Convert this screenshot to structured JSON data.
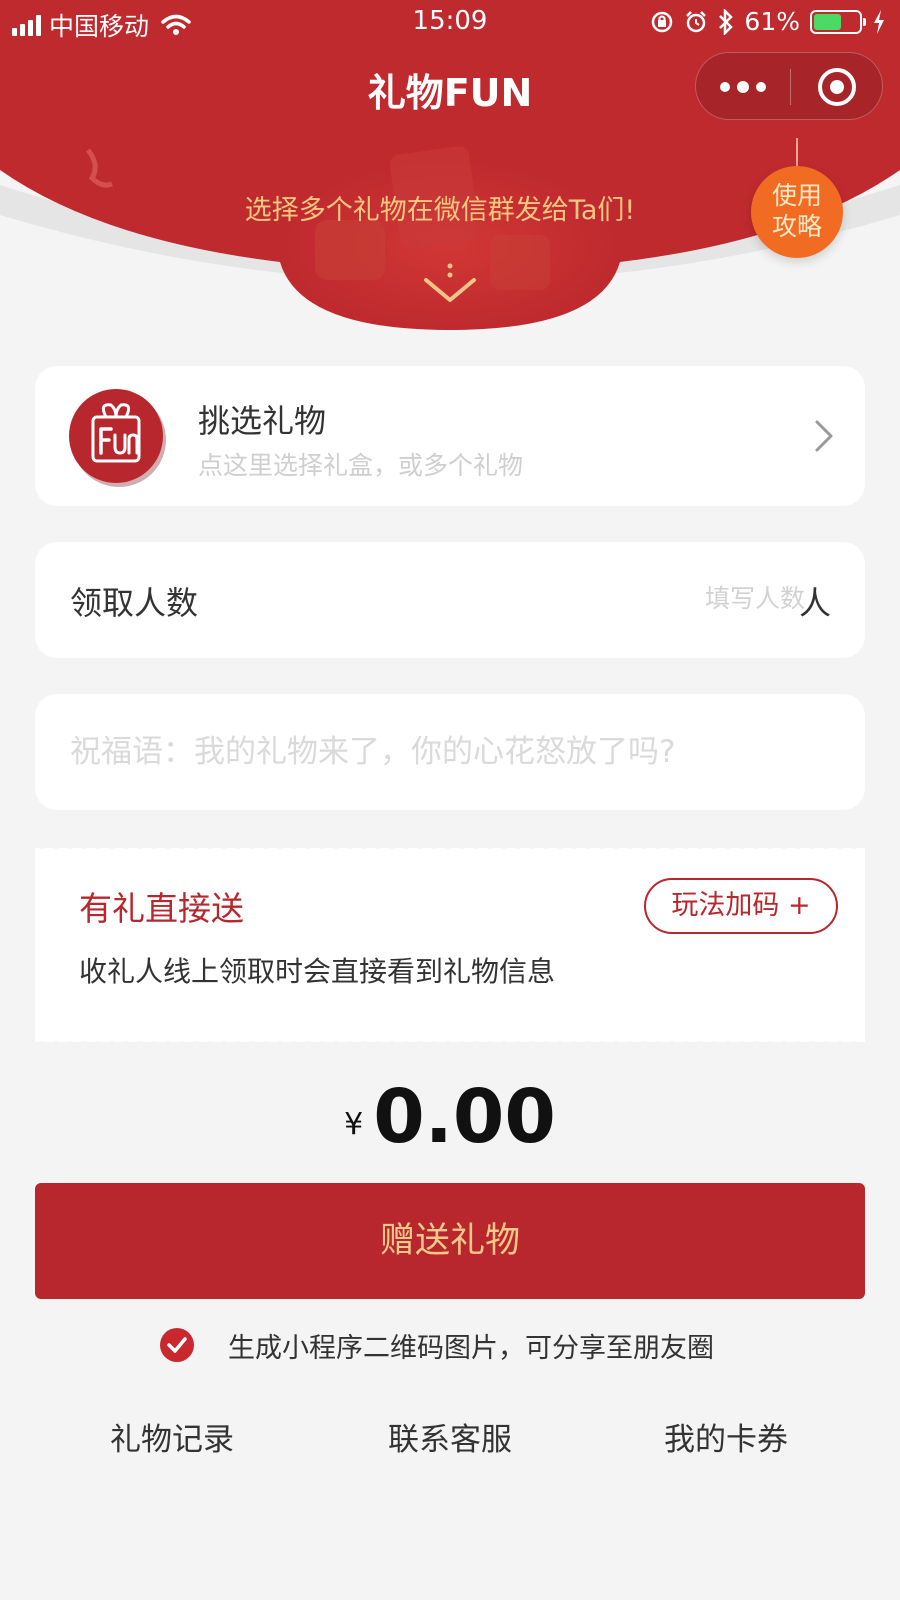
{
  "status_bar": {
    "carrier": "中国移动",
    "time": "15:09",
    "battery_percent": "61%",
    "battery_level": 0.61,
    "icons": [
      "signal-icon",
      "wifi-icon",
      "orientation-lock-icon",
      "alarm-icon",
      "bluetooth-icon",
      "battery-icon",
      "charging-icon"
    ]
  },
  "nav": {
    "title": "礼物FUN",
    "more_icon": "more-dots-icon",
    "close_icon": "target-circle-icon"
  },
  "banner": {
    "text": "选择多个礼物在微信群发给Ta们!",
    "guide_line1": "使用",
    "guide_line2": "攻略",
    "arrow_icon": "chevron-down-icon"
  },
  "gift_picker": {
    "title": "挑选礼物",
    "subtitle": "点这里选择礼盒，或多个礼物",
    "logo_icon": "fun-gift-logo-icon"
  },
  "count": {
    "label": "领取人数",
    "placeholder": "填写人数",
    "unit": "人"
  },
  "blessing": {
    "placeholder": "祝福语：我的礼物来了，你的心花怒放了吗?"
  },
  "mode": {
    "title": "有礼直接送",
    "description": "收礼人线上领取时会直接看到礼物信息",
    "play_button": "玩法加码 +"
  },
  "price": {
    "currency": "¥",
    "amount": "0.00"
  },
  "send_button": "赠送礼物",
  "qr_option": {
    "checked": true,
    "text": "生成小程序二维码图片，可分享至朋友圈"
  },
  "bottom_links": [
    "礼物记录",
    "联系客服",
    "我的卡券"
  ],
  "colors": {
    "brand_red": "#b8272d",
    "banner_red": "#bf2a2f",
    "gold_text": "#f7c77f",
    "guide_orange": "#f26b22",
    "background": "#f4f4f4"
  }
}
